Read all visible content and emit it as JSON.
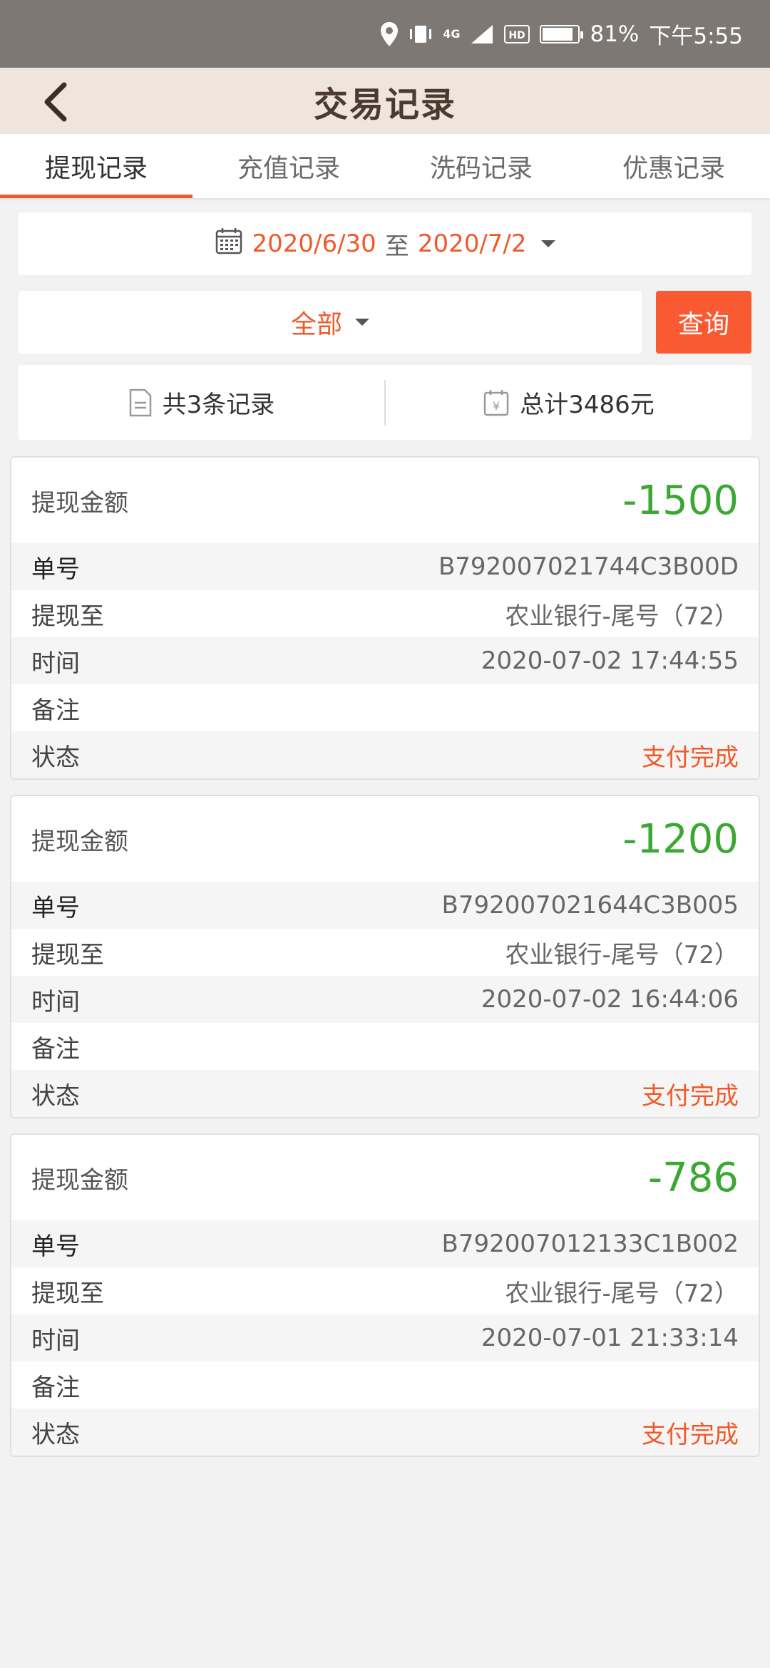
{
  "status_bar": {
    "battery": "81%",
    "time": "下午5:55",
    "network": "4G"
  },
  "header": {
    "title": "交易记录",
    "back_icon": "chevron-left-icon"
  },
  "tabs": [
    {
      "label": "提现记录",
      "active": true
    },
    {
      "label": "充值记录",
      "active": false
    },
    {
      "label": "洗码记录",
      "active": false
    },
    {
      "label": "优惠记录",
      "active": false
    }
  ],
  "date_filter": {
    "start": "2020/6/30",
    "sep": "至",
    "end": "2020/7/2"
  },
  "type_filter": {
    "selected": "全部",
    "query_label": "查询"
  },
  "summary": {
    "count_text": "共3条记录",
    "total_text": "总计3486元"
  },
  "colors": {
    "accent": "#f05a2a",
    "amount_green": "#3aa832",
    "header_bg": "#efe5dc"
  },
  "records": [
    {
      "amount_label": "提现金额",
      "amount": "-1500",
      "rows": [
        {
          "k": "单号",
          "v": "B792007021744C3B00D"
        },
        {
          "k": "提现至",
          "v": "农业银行-尾号（72）"
        },
        {
          "k": "时间",
          "v": "2020-07-02 17:44:55"
        },
        {
          "k": "备注",
          "v": ""
        },
        {
          "k": "状态",
          "v": "支付完成"
        }
      ]
    },
    {
      "amount_label": "提现金额",
      "amount": "-1200",
      "rows": [
        {
          "k": "单号",
          "v": "B792007021644C3B005"
        },
        {
          "k": "提现至",
          "v": "农业银行-尾号（72）"
        },
        {
          "k": "时间",
          "v": "2020-07-02 16:44:06"
        },
        {
          "k": "备注",
          "v": ""
        },
        {
          "k": "状态",
          "v": "支付完成"
        }
      ]
    },
    {
      "amount_label": "提现金额",
      "amount": "-786",
      "rows": [
        {
          "k": "单号",
          "v": "B792007012133C1B002"
        },
        {
          "k": "提现至",
          "v": "农业银行-尾号（72）"
        },
        {
          "k": "时间",
          "v": "2020-07-01 21:33:14"
        },
        {
          "k": "备注",
          "v": ""
        },
        {
          "k": "状态",
          "v": "支付完成"
        }
      ]
    }
  ]
}
